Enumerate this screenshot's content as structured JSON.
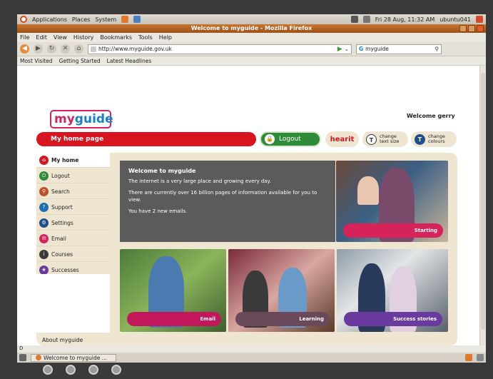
{
  "gnome": {
    "applications": "Applications",
    "places": "Places",
    "system": "System",
    "clock": "Fri 28 Aug, 11:32 AM",
    "user": "ubuntu041"
  },
  "window": {
    "title": "Welcome to myguide - Mozilla Firefox"
  },
  "menu": [
    "File",
    "Edit",
    "View",
    "History",
    "Bookmarks",
    "Tools",
    "Help"
  ],
  "nav": {
    "url": "http://www.myguide.gov.uk",
    "search": "myguide"
  },
  "bookmarks": {
    "most_visited": "Most Visited",
    "getting_started": "Getting Started",
    "latest_headlines": "Latest Headlines"
  },
  "page": {
    "logo_my": "my",
    "logo_guide": "guide",
    "welcome_user": "Welcome gerry",
    "home_bar": "My home page",
    "logout": "Logout",
    "hearit": "hearit",
    "text_size_icon": "T",
    "text_size": "change text size",
    "colours_icon": "T",
    "colours": "change colours",
    "sidebar": [
      {
        "label": "My home",
        "color": "#d8141f"
      },
      {
        "label": "Logout",
        "color": "#2f8b3a"
      },
      {
        "label": "Search",
        "color": "#b8502a"
      },
      {
        "label": "Support",
        "color": "#1e6fb0"
      },
      {
        "label": "Settings",
        "color": "#1e4e8c"
      },
      {
        "label": "Email",
        "color": "#d6245a"
      },
      {
        "label": "Courses",
        "color": "#3a3a3a"
      },
      {
        "label": "Successes",
        "color": "#6a3a9a"
      }
    ],
    "about": "About myguide",
    "welcome_box": {
      "title": "Welcome to myguide",
      "p1": "The internet is a very large place and growing every day.",
      "p2": "There are currently over 16 billion pages of information available for you to view.",
      "p3": "You have 2 new emails."
    },
    "tiles": {
      "starting": "Starting",
      "email": "Email",
      "learning": "Learning",
      "success": "Success stories"
    }
  },
  "status": {
    "find": "D",
    "task": "Welcome to myguide ..."
  },
  "colors": {
    "accent": "#d8141f",
    "logout": "#2f8b3a",
    "panel": "#efe6d2"
  }
}
